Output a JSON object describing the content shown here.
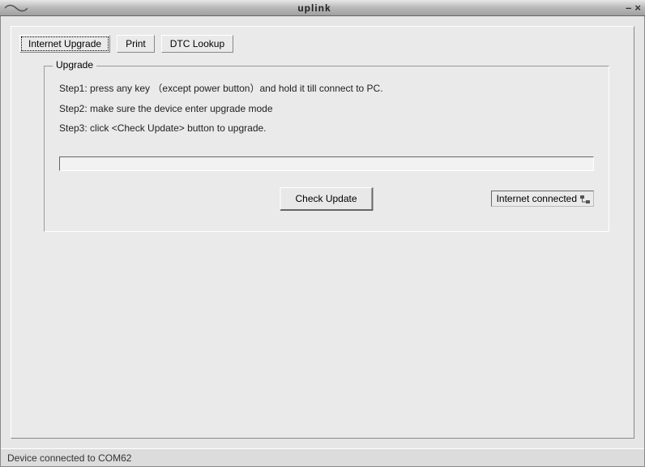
{
  "window": {
    "title": "uplink"
  },
  "tabs": {
    "items": [
      {
        "label": "Internet Upgrade",
        "active": true
      },
      {
        "label": "Print",
        "active": false
      },
      {
        "label": "DTC Lookup",
        "active": false
      }
    ]
  },
  "groupbox": {
    "legend": "Upgrade",
    "step1": "Step1: press any key  （except power button）and hold it till connect to PC.",
    "step2": "Step2: make sure the device enter upgrade mode",
    "step3": "Step3: click <Check Update> button to upgrade.",
    "check_button": "Check Update",
    "connection_status": "Internet connected"
  },
  "statusbar": {
    "text": "Device connected to COM62"
  }
}
